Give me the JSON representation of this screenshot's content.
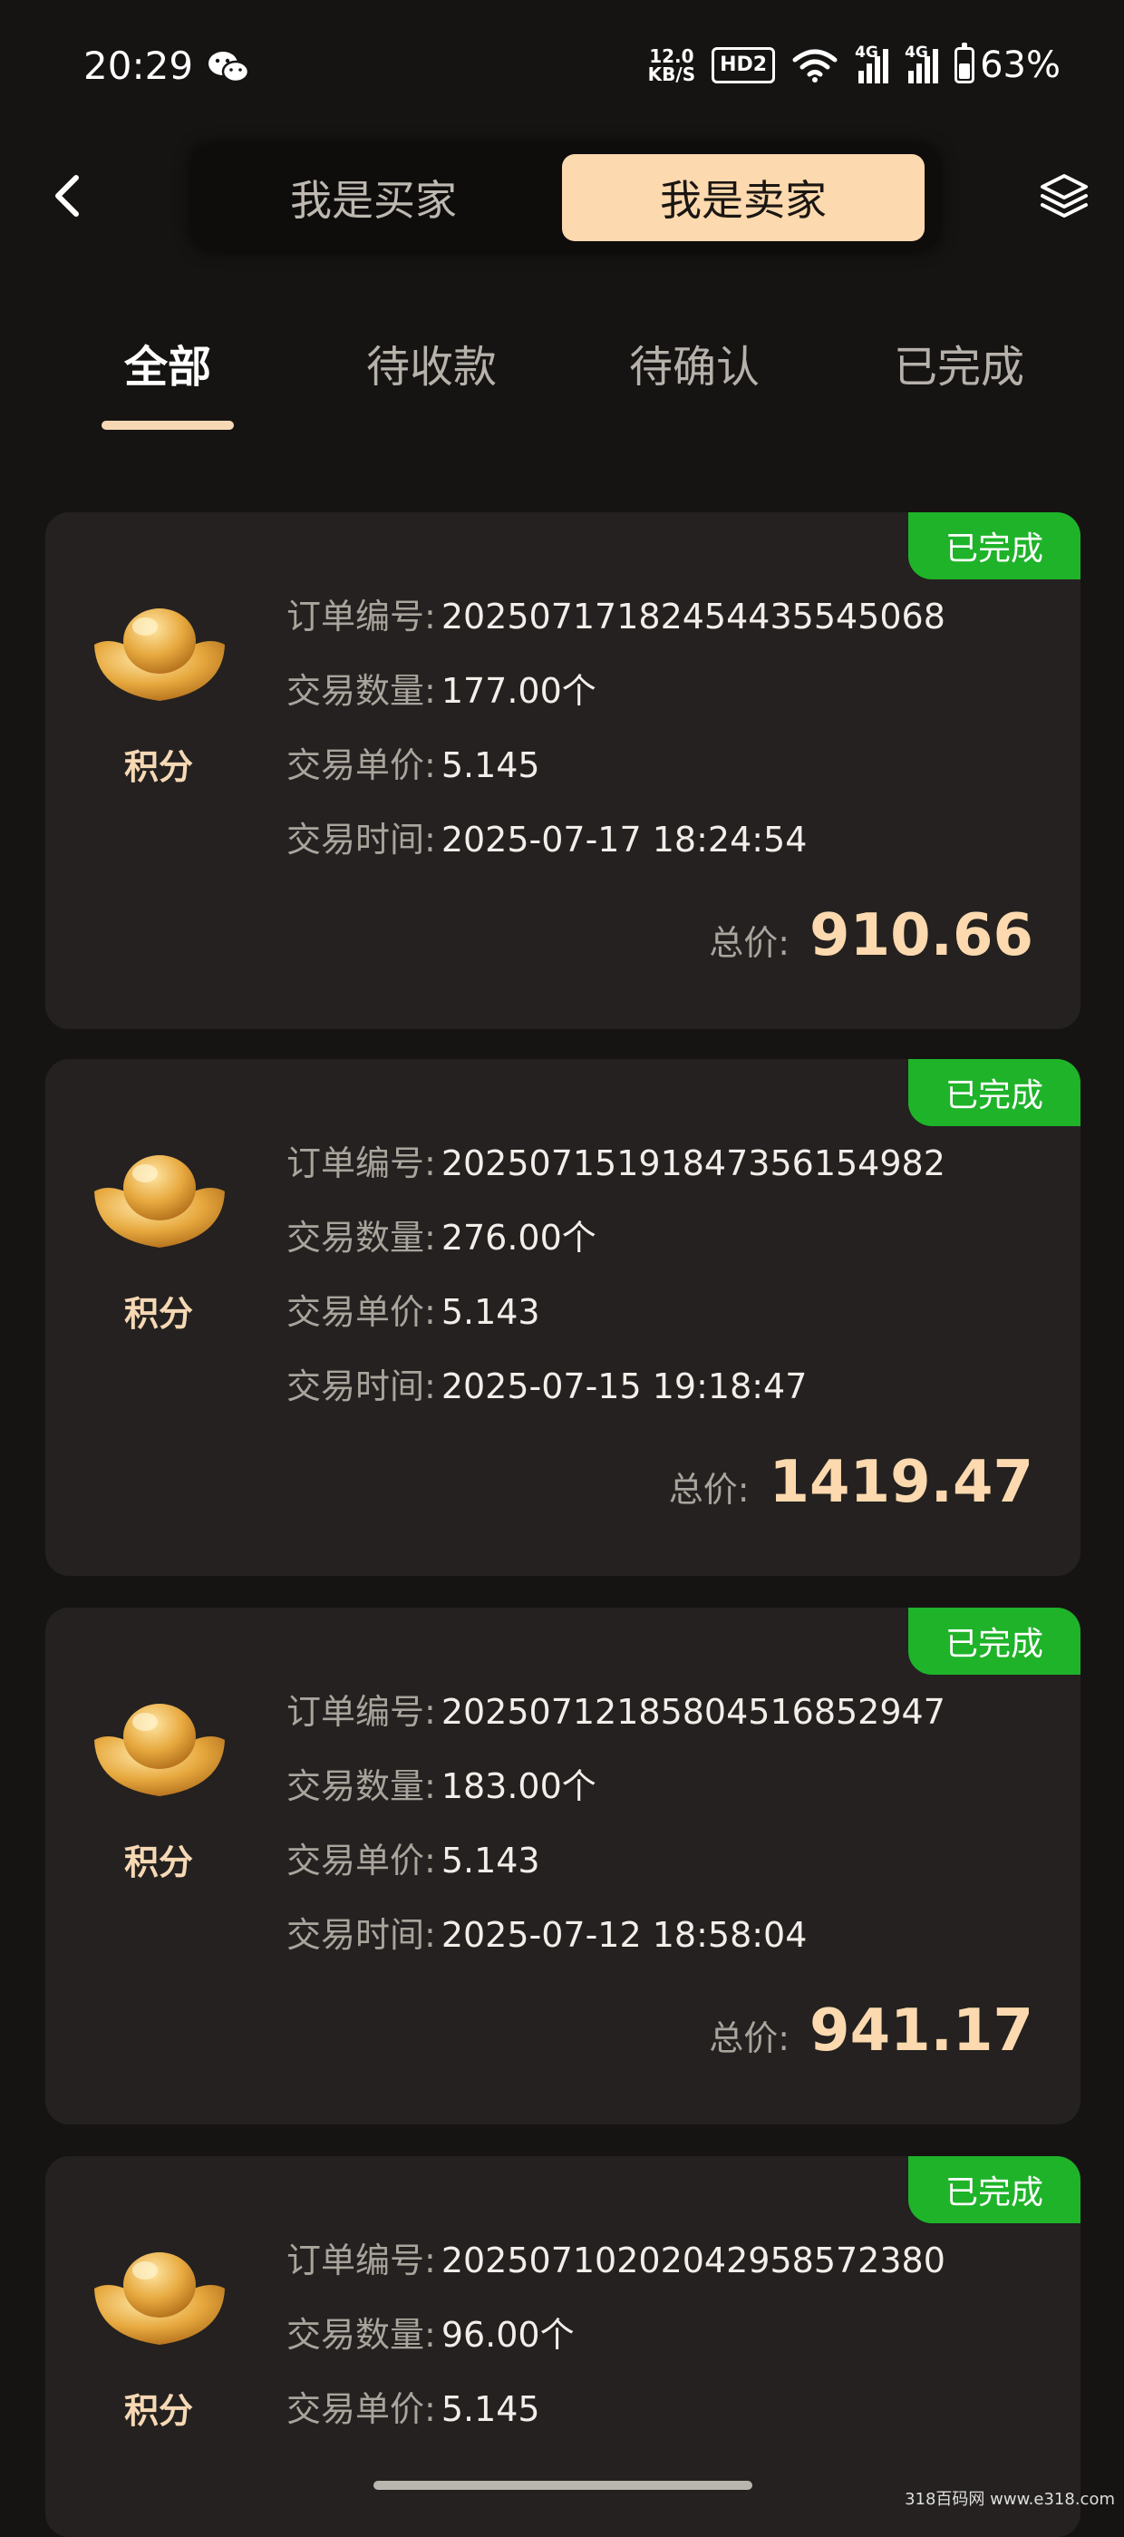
{
  "status_bar": {
    "time": "20:29",
    "net_speed_value": "12.0",
    "net_speed_unit": "KB/S",
    "hd_label": "HD2",
    "signal1_label": "4G",
    "signal2_label": "4G",
    "battery_pct": "63%",
    "battery_level": 0.63
  },
  "header": {
    "buyer_label": "我是买家",
    "seller_label": "我是卖家",
    "active_segment": "seller"
  },
  "tabs": [
    {
      "label": "全部",
      "active": true
    },
    {
      "label": "待收款",
      "active": false
    },
    {
      "label": "待确认",
      "active": false
    },
    {
      "label": "已完成",
      "active": false
    }
  ],
  "orders": [
    {
      "badge": "已完成",
      "coin_label": "积分",
      "order_no_label": "订单编号:",
      "order_no": "20250717182454435545068",
      "qty_label": "交易数量:",
      "qty": "177.00个",
      "price_label": "交易单价:",
      "price": "5.145",
      "time_label": "交易时间:",
      "time": "2025-07-17 18:24:54",
      "total_label": "总价:",
      "total": "910.66"
    },
    {
      "badge": "已完成",
      "coin_label": "积分",
      "order_no_label": "订单编号:",
      "order_no": "20250715191847356154982",
      "qty_label": "交易数量:",
      "qty": "276.00个",
      "price_label": "交易单价:",
      "price": "5.143",
      "time_label": "交易时间:",
      "time": "2025-07-15 19:18:47",
      "total_label": "总价:",
      "total": "1419.47"
    },
    {
      "badge": "已完成",
      "coin_label": "积分",
      "order_no_label": "订单编号:",
      "order_no": "20250712185804516852947",
      "qty_label": "交易数量:",
      "qty": "183.00个",
      "price_label": "交易单价:",
      "price": "5.143",
      "time_label": "交易时间:",
      "time": "2025-07-12 18:58:04",
      "total_label": "总价:",
      "total": "941.17"
    },
    {
      "badge": "已完成",
      "coin_label": "积分",
      "order_no_label": "订单编号:",
      "order_no": "20250710202042958572380",
      "qty_label": "交易数量:",
      "qty": "96.00个",
      "price_label": "交易单价:",
      "price": "5.145"
    }
  ],
  "watermark": "318百码网 www.e318.com",
  "colors": {
    "background": "#161413",
    "card": "#242120",
    "accent": "#fcd9ae",
    "badge_green": "#1fb32a"
  },
  "icons": {
    "back": "chevron-left-icon",
    "layers": "layers-icon",
    "coin": "gold-ingot-icon",
    "wechat": "wechat-icon"
  }
}
